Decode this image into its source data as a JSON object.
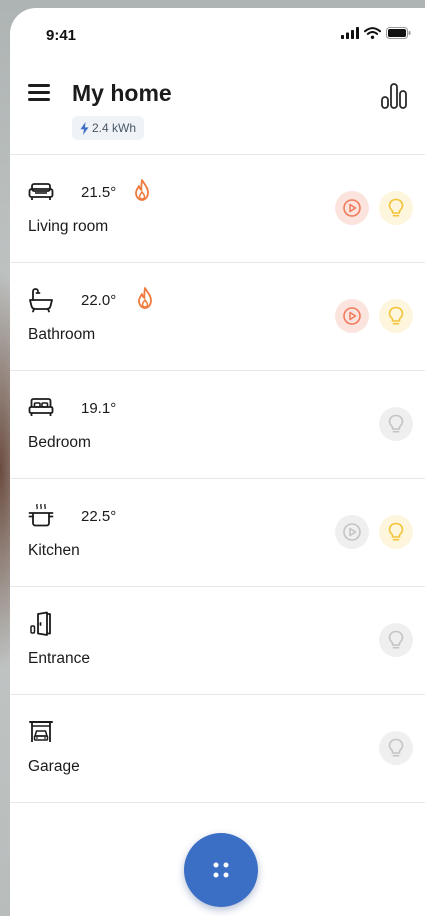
{
  "status": {
    "time": "9:41"
  },
  "header": {
    "title": "My home",
    "energy": "2.4 kWh"
  },
  "colors": {
    "accent": "#3b6fc6",
    "scene_on": "#f07a5c",
    "light_on": "#f2c23a",
    "inactive": "#c4c4c4",
    "flame": "#f07a3c",
    "energy_bolt": "#3b6fc6"
  },
  "rooms": [
    {
      "name": "Living room",
      "temp": "21.5°",
      "icon": "sofa-icon",
      "heating": true,
      "scene": "on",
      "light": "on"
    },
    {
      "name": "Bathroom",
      "temp": "22.0°",
      "icon": "bathtub-icon",
      "heating": true,
      "scene": "on",
      "light": "on"
    },
    {
      "name": "Bedroom",
      "temp": "19.1°",
      "icon": "bed-icon",
      "heating": false,
      "scene": null,
      "light": "off"
    },
    {
      "name": "Kitchen",
      "temp": "22.5°",
      "icon": "cooking-pot-icon",
      "heating": false,
      "scene": "off",
      "light": "on"
    },
    {
      "name": "Entrance",
      "temp": "",
      "icon": "door-icon",
      "heating": false,
      "scene": null,
      "light": "off"
    },
    {
      "name": "Garage",
      "temp": "",
      "icon": "garage-icon",
      "heating": false,
      "scene": null,
      "light": "off"
    }
  ]
}
